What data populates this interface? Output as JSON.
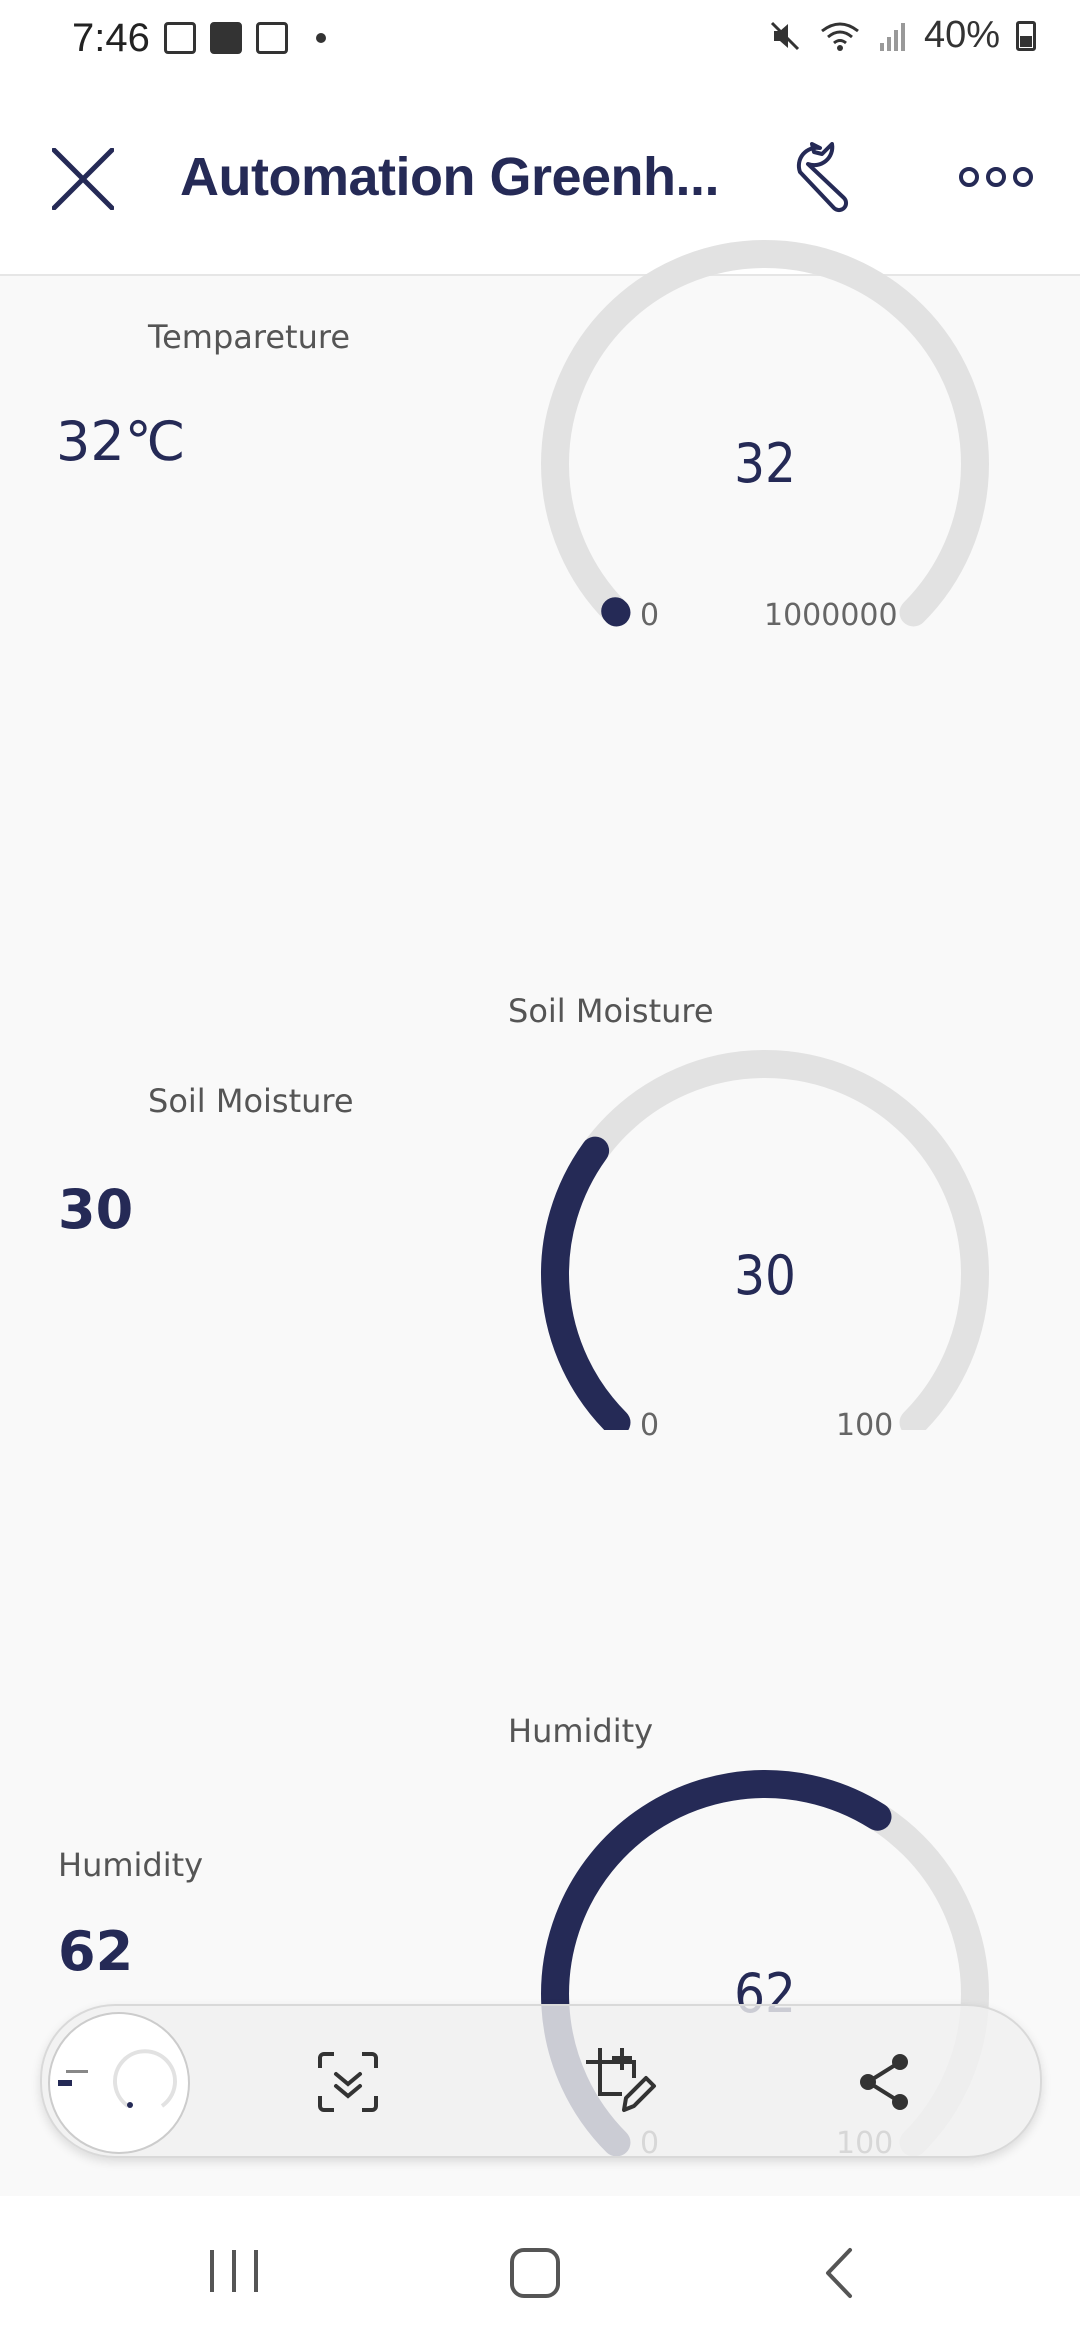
{
  "status_bar": {
    "time": "7:46",
    "notification_icons": [
      "gallery-icon",
      "zomato-icon",
      "calendar-icon"
    ],
    "battery": "40%"
  },
  "app_bar": {
    "title": "Automation Greenh...",
    "close_icon": "close-icon",
    "settings_icon": "wrench-icon",
    "menu_icon": "more-icon"
  },
  "widgets": {
    "temperature": {
      "label": "Tempareture",
      "value": "32℃",
      "gauge_value": "32",
      "gauge_min": "0",
      "gauge_max": "1000000",
      "level": 3.2e-05
    },
    "soil": {
      "gauge_title": "Soil Moisture",
      "label": "Soil Moisture",
      "value": "30",
      "gauge_value": "30",
      "gauge_min": "0",
      "gauge_max": "100",
      "level": 0.3
    },
    "humidity": {
      "gauge_title": "Humidity",
      "label": "Humidity",
      "value": "62",
      "gauge_value": "62",
      "gauge_min": "0",
      "gauge_max": "100",
      "level": 0.62
    }
  },
  "colors": {
    "accent": "#252a56",
    "track": "#e2e2e2"
  },
  "screenshot_toolbar": {
    "icons": [
      "screenshot-thumbnail",
      "scroll-capture-icon",
      "edit-crop-icon",
      "share-icon"
    ]
  },
  "nav_bar": {
    "icons": [
      "recents-icon",
      "home-icon",
      "back-icon"
    ]
  }
}
